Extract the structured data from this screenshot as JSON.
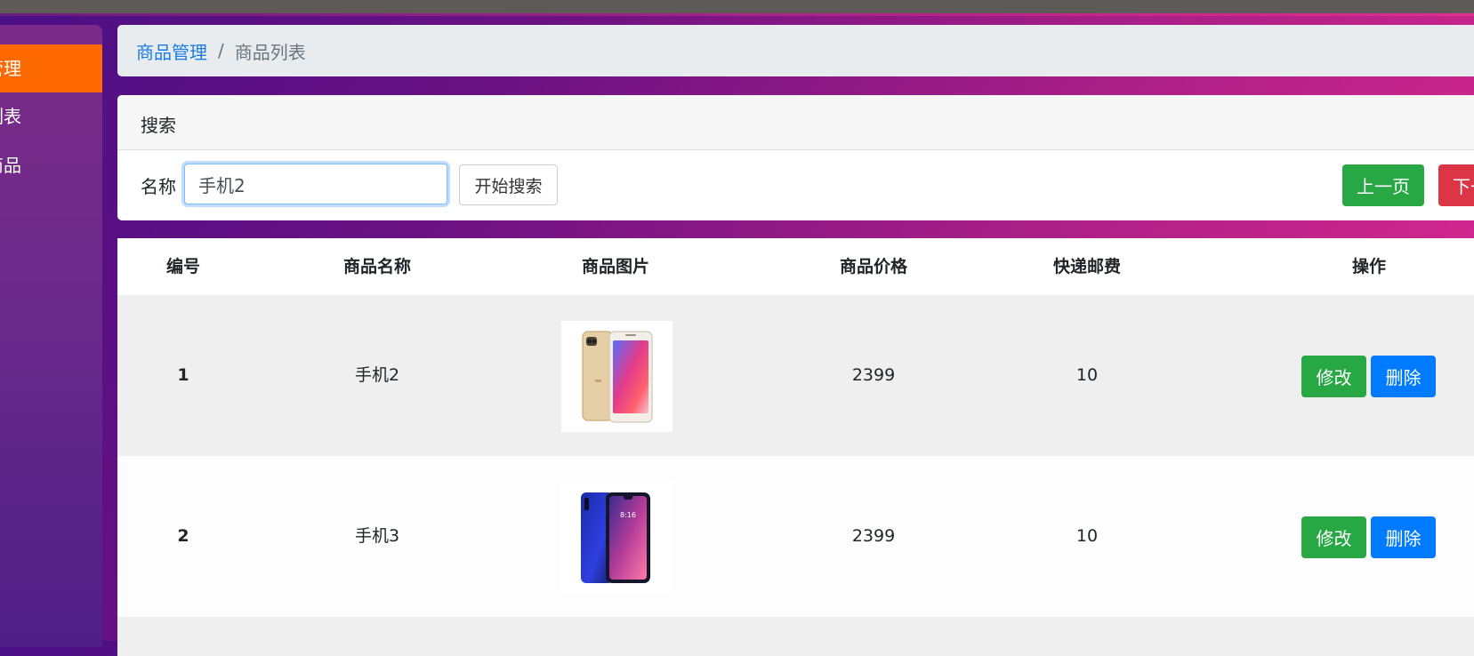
{
  "sidebar": {
    "items": [
      {
        "label": "商品管理",
        "active": true
      },
      {
        "label": "商品列表",
        "active": false
      },
      {
        "label": "添加商品",
        "active": false
      }
    ]
  },
  "breadcrumb": {
    "parent": "商品管理",
    "separator": "/",
    "current": "商品列表"
  },
  "search": {
    "title": "搜索",
    "label": "名称",
    "value": "手机2",
    "button": "开始搜索"
  },
  "pagination": {
    "prev": "上一页",
    "next": "下一页"
  },
  "table": {
    "headers": [
      "编号",
      "商品名称",
      "商品图片",
      "商品价格",
      "快递邮费",
      "操作"
    ],
    "rows": [
      {
        "id": "1",
        "name": "手机2",
        "image": "gold-phone-icon",
        "price": "2399",
        "shipping": "10",
        "edit": "修改",
        "delete": "删除"
      },
      {
        "id": "2",
        "name": "手机3",
        "image": "blue-phone-icon",
        "price": "2399",
        "shipping": "10",
        "edit": "修改",
        "delete": "删除"
      }
    ]
  },
  "colors": {
    "accent": "#ff6a00",
    "link": "#1a7be3",
    "success": "#28a745",
    "danger": "#dc3545",
    "primary": "#007bff"
  }
}
